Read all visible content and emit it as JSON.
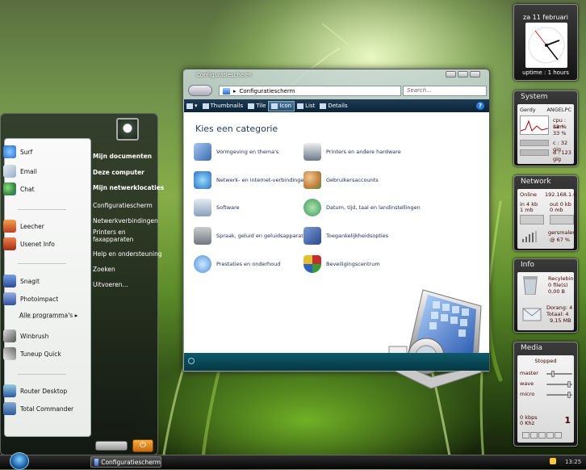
{
  "start_menu": {
    "left_items": [
      {
        "label": "Surf",
        "icon": "ie-globe-icon",
        "color": "#2b6ccf"
      },
      {
        "label": "Email",
        "icon": "mail-envelope-icon",
        "color": "#b0c4d8"
      },
      {
        "label": "Chat",
        "icon": "messenger-people-icon",
        "color": "#4aa04a"
      },
      {
        "label": "Leecher",
        "icon": "house-download-icon",
        "color": "#d06020"
      },
      {
        "label": "Usenet Info",
        "icon": "house-info-icon",
        "color": "#c04020"
      },
      {
        "label": "Snagit",
        "icon": "snagit-icon",
        "color": "#2a4a9a"
      },
      {
        "label": "Photoimpact",
        "icon": "photoimpact-icon",
        "color": "#3050a0"
      },
      {
        "label": "Winbrush",
        "icon": "brush-tools-icon",
        "color": "#707070"
      },
      {
        "label": "Tuneup Quick",
        "icon": "wrench-tools-icon",
        "color": "#707070"
      },
      {
        "label": "Router Desktop",
        "icon": "monitor-icon",
        "color": "#2a5aa0"
      },
      {
        "label": "Total Commander",
        "icon": "floppy-computer-icon",
        "color": "#2a5aa0"
      }
    ],
    "all_programs": "Alle programma's",
    "right_items": [
      "Mijn documenten",
      "Deze computer",
      "Mijn netwerklocaties",
      "Configuratiescherm",
      "Netwerkverbindingen",
      "Printers en faxapparaten",
      "Help en ondersteuning",
      "Zoeken",
      "Uitvoeren..."
    ]
  },
  "window": {
    "title": "Configuratiescherm",
    "address": "Configuratiescherm",
    "search_placeholder": "Search...",
    "toolbar": [
      "Thumbnails",
      "Tile",
      "Icon",
      "List",
      "Details"
    ],
    "help": "?",
    "heading": "Kies een categorie",
    "categories_left": [
      {
        "label": "Vormgeving en thema's",
        "icon": "appearance-monitor-icon",
        "color": "#3a6ab0"
      },
      {
        "label": "Netwerk- en internet-verbindingen",
        "icon": "network-globe-icon",
        "color": "#2a70c0"
      },
      {
        "label": "Software",
        "icon": "software-install-icon",
        "color": "#8aa0b8"
      },
      {
        "label": "Spraak, geluid en geluidsapparaten",
        "icon": "speaker-music-icon",
        "color": "#707880"
      },
      {
        "label": "Prestaties en onderhoud",
        "icon": "performance-pie-icon",
        "color": "#4a90d8"
      }
    ],
    "categories_right": [
      {
        "label": "Printers en andere hardware",
        "icon": "printer-icon",
        "color": "#6a7a8a"
      },
      {
        "label": "Gebruikersaccounts",
        "icon": "user-accounts-icon",
        "color": "#c08040"
      },
      {
        "label": "Datum, tijd, taal en landinstellingen",
        "icon": "globe-clock-icon",
        "color": "#3a9a5a"
      },
      {
        "label": "Toegankelijkheidsopties",
        "icon": "accessibility-icon",
        "color": "#2a4a8a"
      },
      {
        "label": "Beveiligingscentrum",
        "icon": "security-shield-icon",
        "color": "#c03030"
      }
    ]
  },
  "taskbar": {
    "task_label": "Configuratiescherm",
    "time": "13:25"
  },
  "gadgets": {
    "clock": {
      "date": "za 11 februari",
      "uptime": "uptime : 1 hours"
    },
    "system": {
      "title": "System",
      "user": "Gerdy",
      "pc": "ANGELPC",
      "cpu": "cpu : 11 %",
      "ram": "ram : 33 %",
      "disk_c": "c : 32 gig",
      "disk_d": "d : 123 gig"
    },
    "network": {
      "title": "Network",
      "status": "Online",
      "ip": "192.168.1.6",
      "in_rate": "in 4 kb",
      "in_total": "1 mb",
      "out_rate": "out 0 kb",
      "out_total": "0 mb",
      "ssid": "gersmalen",
      "signal": "@ 67 %"
    },
    "info": {
      "title": "Info",
      "recycle_label": "Recylebin",
      "recycle_files": "0 file(s)",
      "recycle_size": "0,00 B",
      "mail_label": "Dorang: 4",
      "mail_total": "Totaal: 4",
      "mail_size": "9,15 MB"
    },
    "media": {
      "title": "Media",
      "status": "Stopped",
      "master": "master",
      "wave": "wave",
      "micro": "micro",
      "kbps": "0 kbps",
      "khz": "0 Khz",
      "track": "1"
    }
  }
}
